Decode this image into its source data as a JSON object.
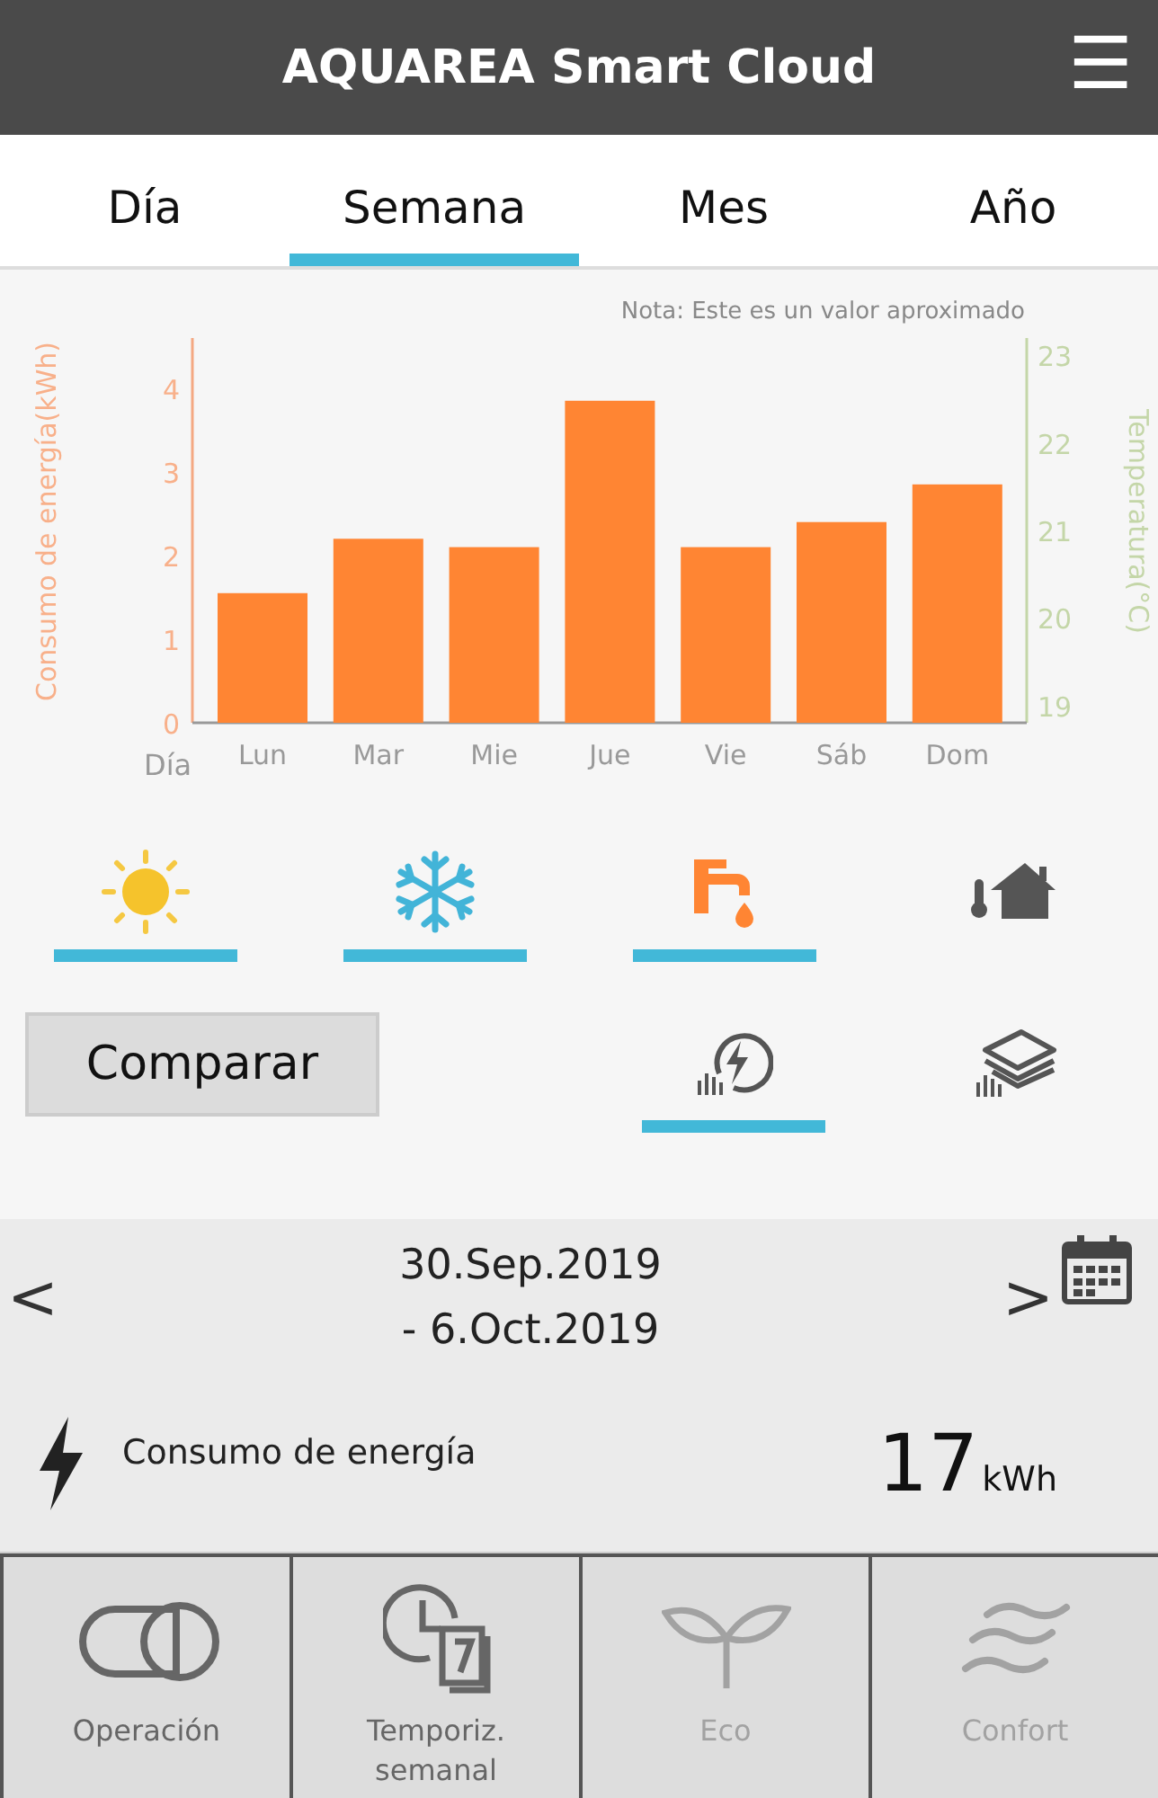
{
  "header": {
    "title": "AQUAREA Smart Cloud",
    "menu_icon": "☰"
  },
  "tabs": [
    {
      "label": "Día",
      "selected": false
    },
    {
      "label": "Semana",
      "selected": true
    },
    {
      "label": "Mes",
      "selected": false
    },
    {
      "label": "Año",
      "selected": false
    }
  ],
  "note": "Nota: Este es un valor aproximado",
  "chart_data": {
    "type": "bar",
    "xlabel": "Día",
    "ylabel": "Consumo de energía(kWh)",
    "categories": [
      "Lun",
      "Mar",
      "Mie",
      "Jue",
      "Vie",
      "Sáb",
      "Dom"
    ],
    "series": [
      {
        "color": "#ff8533",
        "values": [
          1.55,
          2.2,
          2.1,
          3.85,
          2.1,
          2.4,
          2.85
        ]
      }
    ],
    "ylim": [
      0,
      4.6
    ],
    "yticks": [
      0,
      1,
      2,
      3,
      4
    ],
    "y2label": "Temperatura(°C)",
    "y2lim": [
      18.8,
      23.2
    ],
    "y2ticks": [
      19,
      20,
      21,
      22,
      23
    ]
  },
  "modes": [
    {
      "kind": "heat",
      "selected": true
    },
    {
      "kind": "cool",
      "selected": true
    },
    {
      "kind": "tank",
      "selected": true
    },
    {
      "kind": "room",
      "selected": false
    }
  ],
  "compare_button": "Comparar",
  "views": [
    {
      "kind": "energy",
      "selected": true
    },
    {
      "kind": "layers",
      "selected": false
    }
  ],
  "date_nav": {
    "prev": "<",
    "next": ">",
    "range": [
      "30.Sep.2019",
      "- 6.Oct.2019"
    ]
  },
  "energy": {
    "label": "Consumo de energía",
    "value": "17",
    "unit": "kWh"
  },
  "nav": [
    {
      "kind": "operation",
      "label": "Operación",
      "disabled": false
    },
    {
      "kind": "timer",
      "label": "Temporiz. semanal",
      "disabled": false
    },
    {
      "kind": "eco",
      "label": "Eco",
      "disabled": true
    },
    {
      "kind": "comfort",
      "label": "Confort",
      "disabled": true
    }
  ]
}
